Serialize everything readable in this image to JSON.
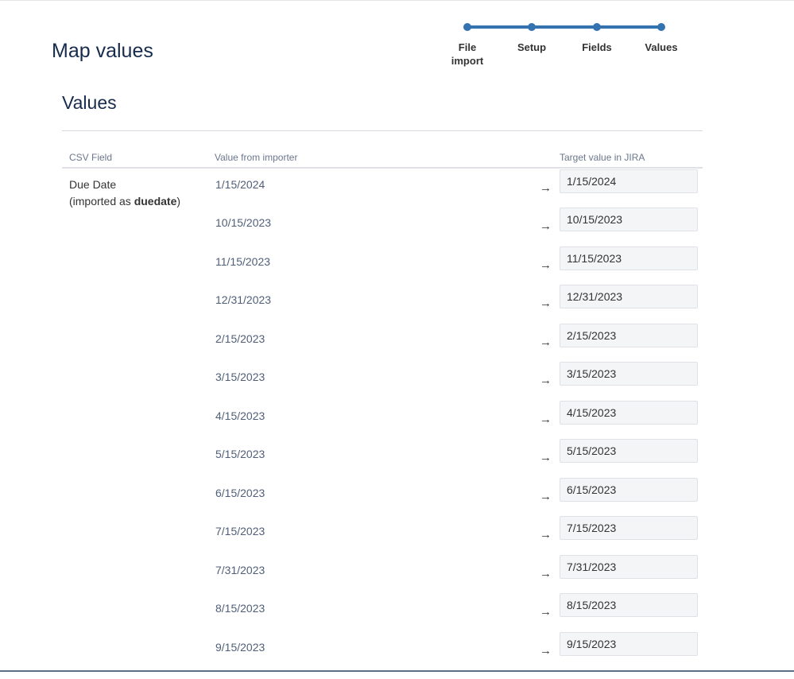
{
  "page": {
    "title": "Map values"
  },
  "progress": {
    "steps": [
      {
        "label": "File import"
      },
      {
        "label": "Setup"
      },
      {
        "label": "Fields"
      },
      {
        "label": "Values"
      }
    ]
  },
  "section": {
    "title": "Values"
  },
  "table": {
    "headers": {
      "csv_field": "CSV Field",
      "value_from_importer": "Value from importer",
      "target_value": "Target value in JIRA"
    },
    "field": {
      "name": "Due Date",
      "imported_prefix": "(imported as ",
      "imported_key": "duedate",
      "imported_suffix": ")"
    },
    "arrow_glyph": "→",
    "rows": [
      {
        "source": "1/15/2024",
        "target": "1/15/2024"
      },
      {
        "source": "10/15/2023",
        "target": "10/15/2023"
      },
      {
        "source": "11/15/2023",
        "target": "11/15/2023"
      },
      {
        "source": "12/31/2023",
        "target": "12/31/2023"
      },
      {
        "source": "2/15/2023",
        "target": "2/15/2023"
      },
      {
        "source": "3/15/2023",
        "target": "3/15/2023"
      },
      {
        "source": "4/15/2023",
        "target": "4/15/2023"
      },
      {
        "source": "5/15/2023",
        "target": "5/15/2023"
      },
      {
        "source": "6/15/2023",
        "target": "6/15/2023"
      },
      {
        "source": "7/15/2023",
        "target": "7/15/2023"
      },
      {
        "source": "7/31/2023",
        "target": "7/31/2023"
      },
      {
        "source": "8/15/2023",
        "target": "8/15/2023"
      },
      {
        "source": "9/15/2023",
        "target": "9/15/2023"
      }
    ]
  },
  "colors": {
    "accent": "#3572b0",
    "title_text": "#172b4d",
    "header_text": "#6b778c",
    "input_background": "#f4f5f7"
  }
}
